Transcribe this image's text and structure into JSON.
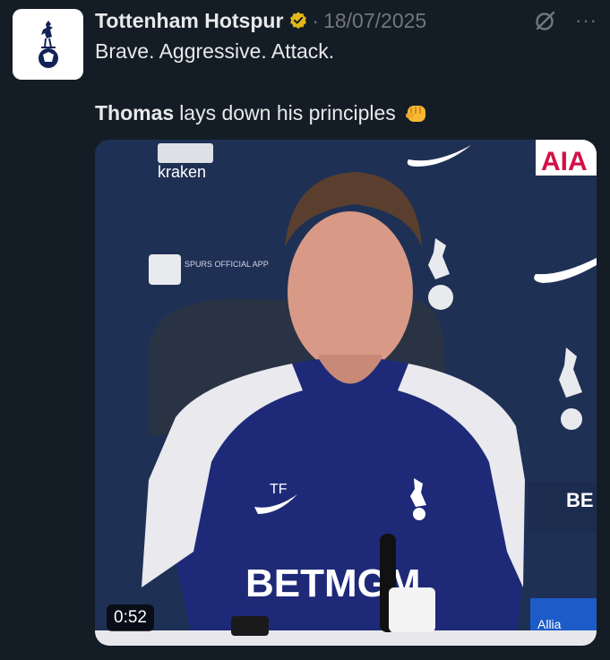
{
  "tweet": {
    "author_name": "Tottenham Hotspur",
    "separator": "·",
    "date": "18/07/2025",
    "more_label": "···",
    "text_line1": "Brave. Aggressive. Attack.",
    "text_line2_bold": "Thomas",
    "text_line2_rest": "lays down his principles"
  },
  "media": {
    "duration": "0:52",
    "backdrop_labels": {
      "kraken": "kraken",
      "aia": "AIA",
      "spurs_app": "SPURS OFFICIAL APP",
      "shirt_initials": "TF",
      "shirt_sponsor": "BETMGM",
      "board_sponsor": "BE MG",
      "corner_sponsor": "Allia"
    }
  },
  "colors": {
    "background": "#141d26",
    "text": "#e7e9ea",
    "muted": "#71767b",
    "verified_gold": "#e2b719",
    "spurs_navy": "#132257"
  },
  "icons": [
    "spurs-logo-icon",
    "verified-badge-icon",
    "grok-icon",
    "more-icon",
    "fist-emoji-icon"
  ]
}
